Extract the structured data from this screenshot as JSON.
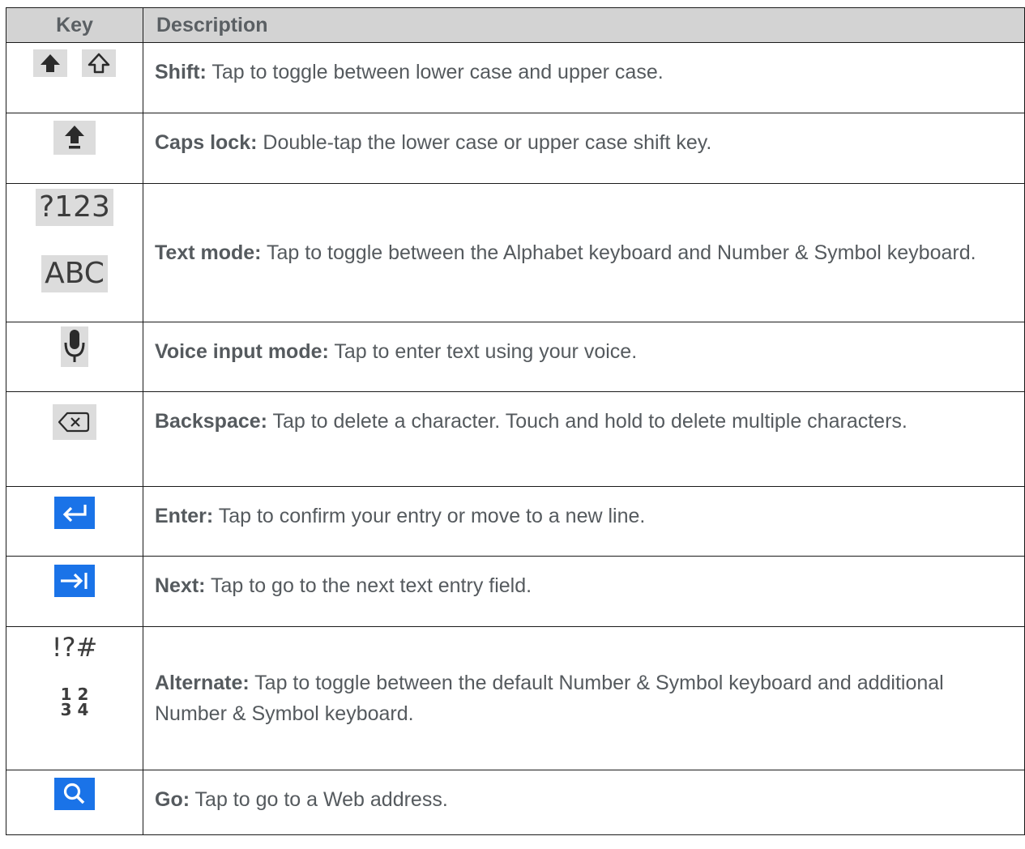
{
  "header": {
    "key": "Key",
    "description": "Description"
  },
  "rows": [
    {
      "label": "Shift:",
      "text": " Tap to toggle between lower case and upper case.",
      "icons": [
        "shift-filled-icon",
        "shift-outline-icon"
      ]
    },
    {
      "label": "Caps lock:",
      "text": " Double-tap the lower case or upper case shift key.",
      "icons": [
        "caps-lock-icon"
      ]
    },
    {
      "label": "Text mode:",
      "text": " Tap to toggle between the Alphabet keyboard and Number & Symbol keyboard.",
      "keys": [
        "?123",
        "ABC"
      ]
    },
    {
      "label": "Voice input mode:",
      "text": " Tap to enter text using your voice.",
      "icons": [
        "microphone-icon"
      ]
    },
    {
      "label": "Backspace:",
      "text": " Tap to delete a character. Touch and hold to delete multiple characters.",
      "icons": [
        "backspace-icon"
      ]
    },
    {
      "label": "Enter:",
      "text": " Tap to confirm your entry or move to a new line.",
      "icons": [
        "enter-icon"
      ]
    },
    {
      "label": "Next:",
      "text": " Tap to go to the next text entry field.",
      "icons": [
        "next-icon"
      ]
    },
    {
      "label": "Alternate:",
      "text": " Tap to toggle between the default Number & Symbol keyboard and additional Number & Symbol keyboard.",
      "keys": [
        "!?#",
        "1 2",
        "3 4"
      ]
    },
    {
      "label": "Go:",
      "text": " Tap to go to a Web address.",
      "icons": [
        "search-icon"
      ]
    }
  ],
  "colors": {
    "header_bg": "#d3d3d3",
    "key_bg": "#dcdcdc",
    "accent": "#1a73e8",
    "text": "#555a5e"
  }
}
